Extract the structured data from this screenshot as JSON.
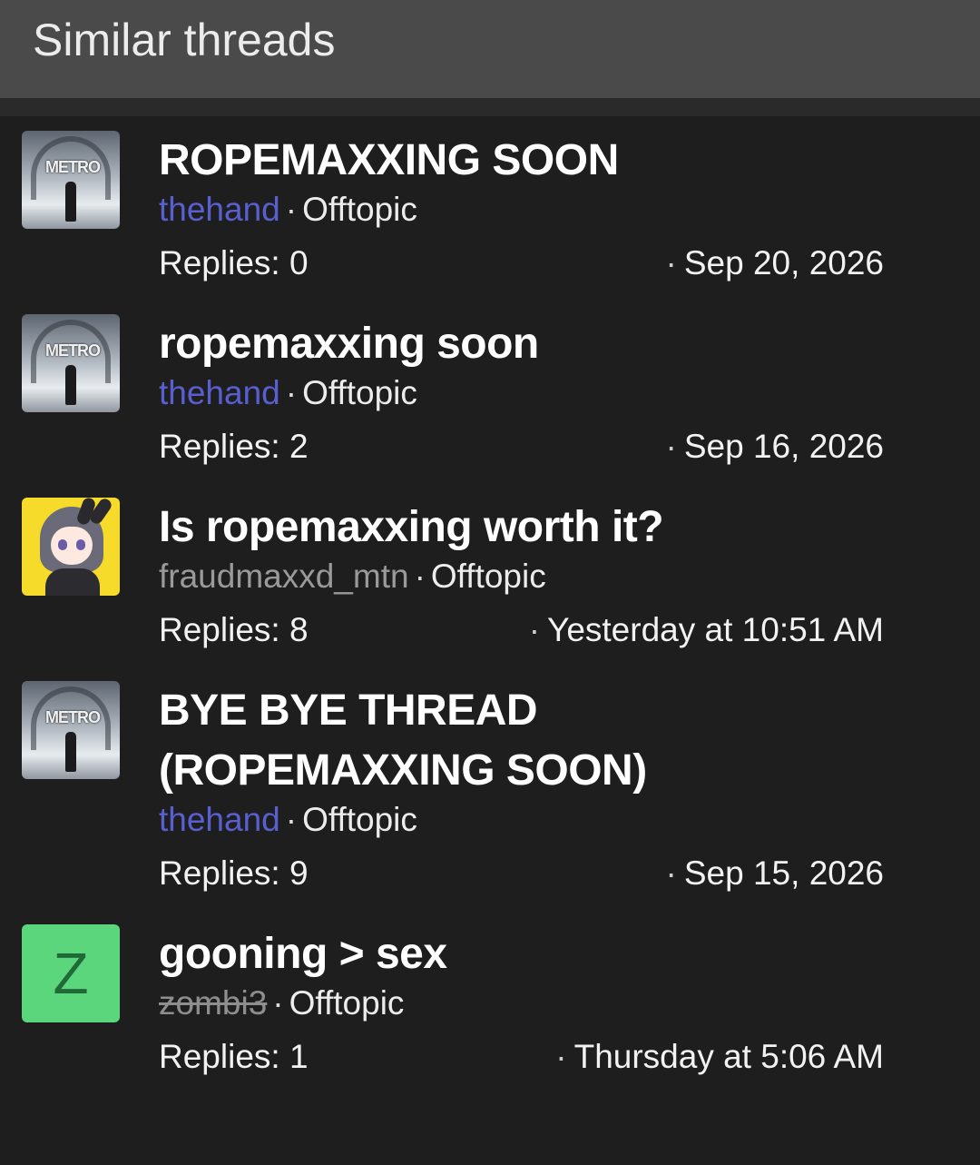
{
  "header": {
    "title": "Similar threads"
  },
  "threads": [
    {
      "title": "ROPEMAXXING SOON",
      "author": "thehand",
      "forum": "Offtopic",
      "replies": "Replies: 0",
      "date": "Sep 20, 2026",
      "avatar": "metro"
    },
    {
      "title": "ropemaxxing soon",
      "author": "thehand",
      "forum": "Offtopic",
      "replies": "Replies: 2",
      "date": "Sep 16, 2026",
      "avatar": "metro"
    },
    {
      "title": "Is ropemaxxing worth it?",
      "author": "fraudmaxxd_mtn",
      "forum": "Offtopic",
      "replies": "Replies: 8",
      "date": "Yesterday at 10:51 AM",
      "avatar": "anime"
    },
    {
      "title": "BYE BYE THREAD (ROPEMAXXING SOON)",
      "author": "thehand",
      "forum": "Offtopic",
      "replies": "Replies: 9",
      "date": "Sep 15, 2026",
      "avatar": "metro"
    },
    {
      "title": "gooning > sex",
      "author": "zombi3",
      "forum": "Offtopic",
      "replies": "Replies: 1",
      "date": "Thursday at 5:06 AM",
      "avatar": "Z"
    }
  ],
  "separator": "·",
  "metro_logo": "METRO",
  "colors": {
    "author_link": "#5a5fd0",
    "background": "#1e1e1f",
    "header": "#4a4a4b",
    "avatar_z": "#5cd67c"
  }
}
